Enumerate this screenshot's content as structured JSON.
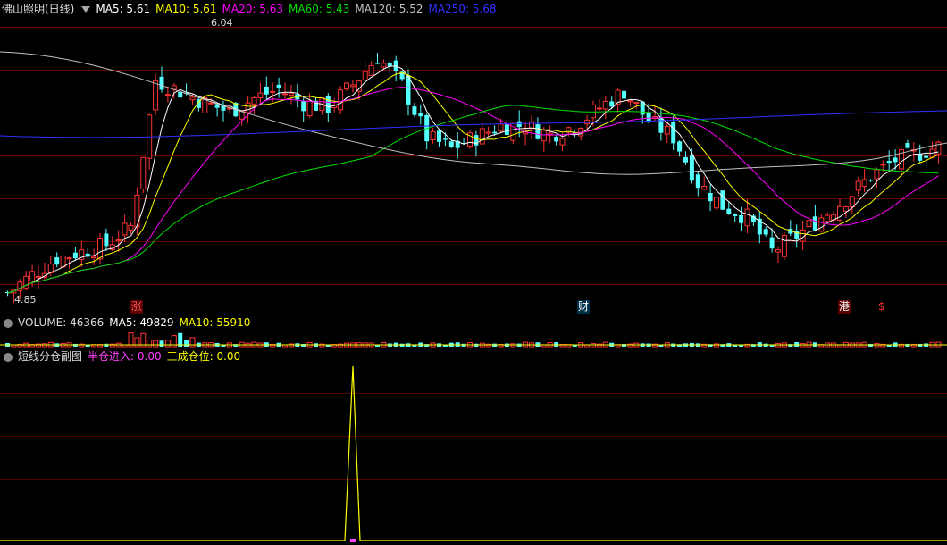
{
  "main_panel": {
    "stock_name": "佛山照明(日线)",
    "ma_labels": [
      {
        "text": "MA5: 5.61",
        "color": "#ffffff"
      },
      {
        "text": "MA10: 5.61",
        "color": "#ffff00"
      },
      {
        "text": "MA20: 5.63",
        "color": "#ff00ff"
      },
      {
        "text": "MA60: 5.43",
        "color": "#00e000"
      },
      {
        "text": "MA120: 5.52",
        "color": "#c0c0c0"
      },
      {
        "text": "MA250: 5.68",
        "color": "#3030ff"
      }
    ],
    "high_label": "6.04",
    "low_label": "4.85",
    "event_tags": [
      {
        "text": "涨",
        "bg": "#5a0000",
        "color": "#ff6060"
      },
      {
        "text": "财",
        "bg": "#00304a",
        "color": "#ffffff"
      },
      {
        "text": "港",
        "bg": "#5a0000",
        "color": "#ffffff"
      },
      {
        "text": "$",
        "bg": "#000000",
        "color": "#ff3030"
      }
    ]
  },
  "volume_panel": {
    "label": "VOLUME: 46366",
    "ma5": "MA5: 49829",
    "ma10": "MA10: 55910"
  },
  "indicator_panel": {
    "title": "短线分仓副图",
    "half_entry": "半仓进入: 0.00",
    "thirty_pct": "三成仓位: 0.00"
  },
  "colors": {
    "up": "#ff3232",
    "down": "#54ffff",
    "grid": "#8b0000"
  }
}
